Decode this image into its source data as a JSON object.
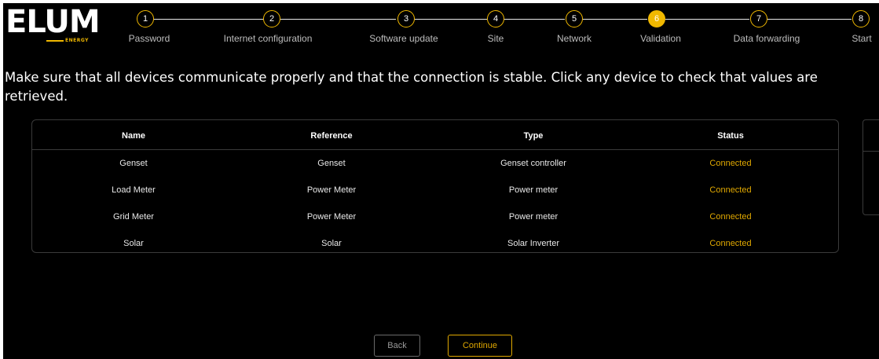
{
  "brand": {
    "name": "ELUM",
    "subtitle": "ENERGY",
    "accent": "#f0b800"
  },
  "steps": [
    {
      "number": "1",
      "label": "Password"
    },
    {
      "number": "2",
      "label": "Internet configuration"
    },
    {
      "number": "3",
      "label": "Software update"
    },
    {
      "number": "4",
      "label": "Site"
    },
    {
      "number": "5",
      "label": "Network"
    },
    {
      "number": "6",
      "label": "Validation"
    },
    {
      "number": "7",
      "label": "Data forwarding"
    },
    {
      "number": "8",
      "label": "Start"
    }
  ],
  "active_step": "6",
  "instruction": "Make sure that all devices communicate properly and that the connection is stable. Click any device to check that values are retrieved.",
  "table": {
    "columns": [
      "Name",
      "Reference",
      "Type",
      "Status"
    ],
    "rows": [
      {
        "name": "Genset",
        "reference": "Genset",
        "type": "Genset controller",
        "status": "Connected"
      },
      {
        "name": "Load Meter",
        "reference": "Power Meter",
        "type": "Power meter",
        "status": "Connected"
      },
      {
        "name": "Grid Meter",
        "reference": "Power Meter",
        "type": "Power meter",
        "status": "Connected"
      },
      {
        "name": "Solar",
        "reference": "Solar",
        "type": "Solar Inverter",
        "status": "Connected"
      }
    ],
    "status_color": "#e0a800"
  },
  "buttons": {
    "back_label": "Back",
    "continue_label": "Continue"
  }
}
